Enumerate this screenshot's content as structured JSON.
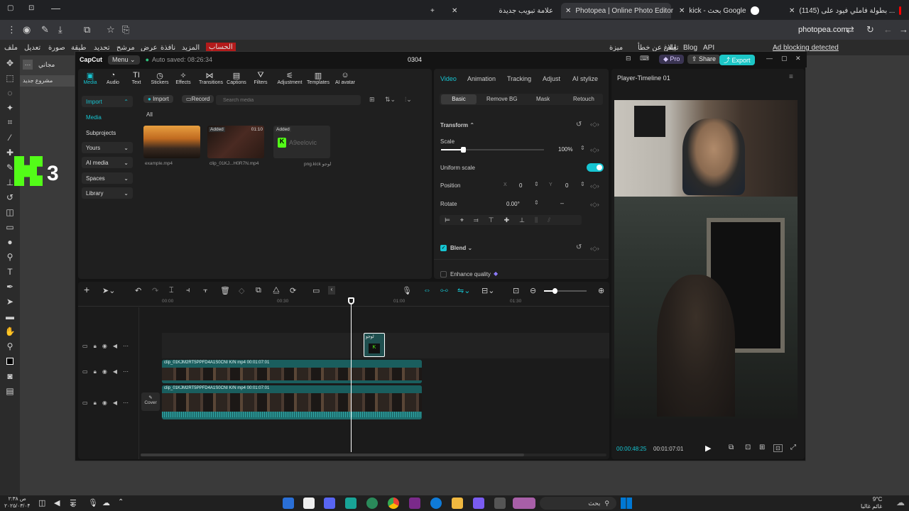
{
  "browser": {
    "tabs": [
      {
        "label": "(1145) بطولة فاملي فيود على ..."
      },
      {
        "label": "kick - بحث Google"
      },
      {
        "label": "Photopea | Online Photo Editor"
      },
      {
        "label": "علامة تبويب جديدة"
      }
    ],
    "url": "photopea.com"
  },
  "photopea": {
    "menu": [
      "ملف",
      "تعديل",
      "صورة",
      "طبقة",
      "تحديد",
      "مرشح",
      "عرض",
      "نافذة",
      "المزيد",
      "الحساب"
    ],
    "right_menu": [
      "Blog",
      "API",
      "تعلم",
      "إبلاغ عن خطأ",
      "ميزة",
      "Ad blocking detected"
    ],
    "doc_tab": "مشروع جديد",
    "btn_free": "مجاني",
    "overlay_num": "3"
  },
  "capcut": {
    "app_name": "CapCut",
    "menu_label": "Menu",
    "autosave": "Auto saved: 08:26:34",
    "project_name": "0304",
    "pro_label": "Pro",
    "share_label": "Share",
    "export_label": "Export",
    "media_tabs": [
      "Media",
      "Audio",
      "Text",
      "Stickers",
      "Effects",
      "Transitions",
      "Captions",
      "Filters",
      "Adjustment",
      "Templates",
      "AI avatar"
    ],
    "sidebar": [
      "Import",
      "Media",
      "Subprojects",
      "Yours",
      "AI media",
      "Spaces",
      "Library"
    ],
    "import_btn": "Import",
    "record_btn": "Record",
    "search_placeholder": "Search media",
    "filter_all": "All",
    "media_items": [
      {
        "name": "example.mp4",
        "badge": ""
      },
      {
        "name": "clip_01KJ...H0R7N.mp4",
        "badge": "Added",
        "duration": "01:10"
      },
      {
        "name": "png.kick لوجو",
        "badge": "Added",
        "title": "A9eelovic"
      }
    ],
    "prop_tabs": [
      "Video",
      "Animation",
      "Tracking",
      "Adjust",
      "AI stylize"
    ],
    "sub_tabs": [
      "Basic",
      "Remove BG",
      "Mask",
      "Retouch"
    ],
    "transform_label": "Transform",
    "scale_label": "Scale",
    "scale_value": "100%",
    "uniform_label": "Uniform scale",
    "position_label": "Position",
    "pos_x": "0",
    "pos_y": "0",
    "x_label": "X",
    "y_label": "Y",
    "rotate_label": "Rotate",
    "rotate_value": "0.00°",
    "blend_label": "Blend",
    "enhance_label": "Enhance quality",
    "player_title": "Player-Timeline 01",
    "time_current": "00:00:48:25",
    "time_total": "00:01:07:01",
    "ruler": [
      "00:00",
      "00:30",
      "01:00",
      "01:30"
    ],
    "cover_label": "Cover",
    "clip1_label": "clip_01KJM2RT5PPFD4A1S0CNI K/N mp4  00:01:07:01",
    "clip2_label": "clip_01KJM2RT5PPFD4A1S0CNI K/N mp4  00:01:07:01",
    "overlay_clip": "لوجو"
  },
  "taskbar": {
    "search": "بحث",
    "time": "۲:۳۸ ص",
    "date": "۲۰۲۵/۰۳/۰۴",
    "weather_temp": "9°C",
    "weather_text": "غائم غالبا",
    "lang": "ع"
  },
  "colors": {
    "accent": "#16c5d2",
    "pro": "#6b5bd6",
    "export": "#1cc6c6",
    "kick": "#53fc18"
  }
}
